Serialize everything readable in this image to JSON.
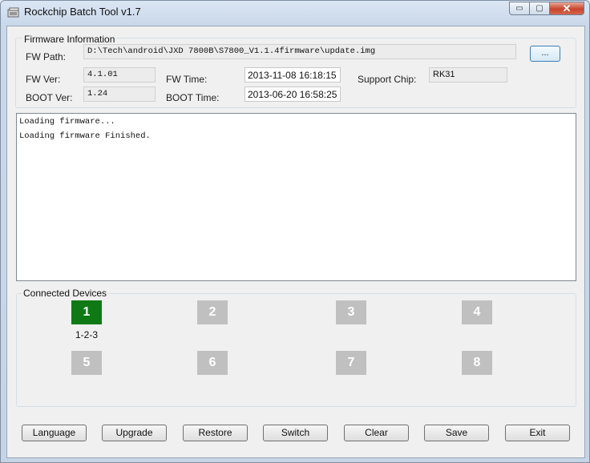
{
  "window": {
    "title": "Rockchip Batch Tool v1.7",
    "controls": {
      "minimize": "▭",
      "maximize": "▢",
      "close": "✕"
    }
  },
  "firmware": {
    "group_label": "Firmware Information",
    "fw_path_label": "FW Path:",
    "fw_path_value": "D:\\Tech\\android\\JXD 7800B\\S7800_V1.1.4firmware\\update.img",
    "browse_label": "...",
    "fw_ver_label": "FW Ver:",
    "fw_ver_value": "4.1.01",
    "boot_ver_label": "BOOT Ver:",
    "boot_ver_value": "1.24",
    "fw_time_label": "FW Time:",
    "fw_time_value": "2013-11-08 16:18:15",
    "boot_time_label": "BOOT Time:",
    "boot_time_value": "2013-06-20 16:58:25",
    "support_chip_label": "Support Chip:",
    "support_chip_value": "RK31"
  },
  "log": {
    "lines": [
      "Loading firmware...",
      "Loading firmware Finished."
    ]
  },
  "devices": {
    "group_label": "Connected Devices",
    "slots": [
      {
        "label": "1",
        "caption": "1-2-3",
        "active": true
      },
      {
        "label": "2",
        "caption": "",
        "active": false
      },
      {
        "label": "3",
        "caption": "",
        "active": false
      },
      {
        "label": "4",
        "caption": "",
        "active": false
      },
      {
        "label": "5",
        "caption": "",
        "active": false
      },
      {
        "label": "6",
        "caption": "",
        "active": false
      },
      {
        "label": "7",
        "caption": "",
        "active": false
      },
      {
        "label": "8",
        "caption": "",
        "active": false
      }
    ],
    "colors": {
      "active": "#0f7a15",
      "inactive": "#c0c0c0"
    }
  },
  "buttons": {
    "language": "Language",
    "upgrade": "Upgrade",
    "restore": "Restore",
    "switch": "Switch",
    "clear": "Clear",
    "save": "Save",
    "exit": "Exit"
  }
}
